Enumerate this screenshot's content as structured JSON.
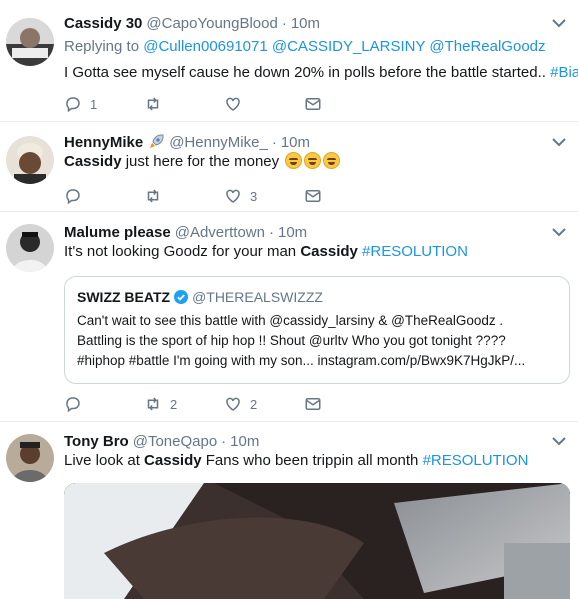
{
  "tweets": [
    {
      "name": "Cassidy 30",
      "handle": "@CapoYoungBlood",
      "time": "10m",
      "reply_prefix": "Replying to",
      "reply_to": "@Cullen00691071 @CASSIDY_LARSINY @TheRealGoodz",
      "text": "I Gotta see myself cause he down 20% in polls before the battle started..",
      "hashtag": "#Bias",
      "reply_count": "1",
      "retweet_count": "",
      "like_count": ""
    },
    {
      "name": "HennyMike",
      "handle": "@HennyMike_",
      "time": "10m",
      "text_bold": "Cassidy",
      "text": " just here for the money",
      "reply_count": "",
      "retweet_count": "",
      "like_count": "3"
    },
    {
      "name": "Malume please",
      "handle": "@Adverttown",
      "time": "10m",
      "text_pre": "It's not looking Goodz for your man ",
      "text_bold": "Cassidy",
      "hashtag": "#RESOLUTION",
      "quote": {
        "name": "SWIZZ BEATZ",
        "handle": "@THEREALSWIZZZ",
        "line1": "Can't wait to see this battle with @cassidy_larsiny & @TheRealGoodz  .",
        "line2": "Battling is the sport of hip hop !! Shout @urltv Who you got tonight ????",
        "line3": "#hiphop #battle I'm going with my son... instagram.com/p/Bwx9K7HgJkP/..."
      },
      "reply_count": "",
      "retweet_count": "2",
      "like_count": "2"
    },
    {
      "name": "Tony Bro",
      "handle": "@ToneQapo",
      "time": "10m",
      "text_pre": "Live look at ",
      "text_bold": "Cassidy",
      "text_post": " Fans who been trippin all month",
      "hashtag": "#RESOLUTION"
    }
  ],
  "colors": {
    "link": "#1b95e0",
    "muted": "#657786",
    "divider": "#e6ecf0"
  },
  "icons": [
    "reply-icon",
    "retweet-icon",
    "like-icon",
    "dm-icon",
    "chevron-down-icon",
    "verified-badge-icon",
    "rocket-emoji-icon",
    "laughing-emoji-icon"
  ]
}
